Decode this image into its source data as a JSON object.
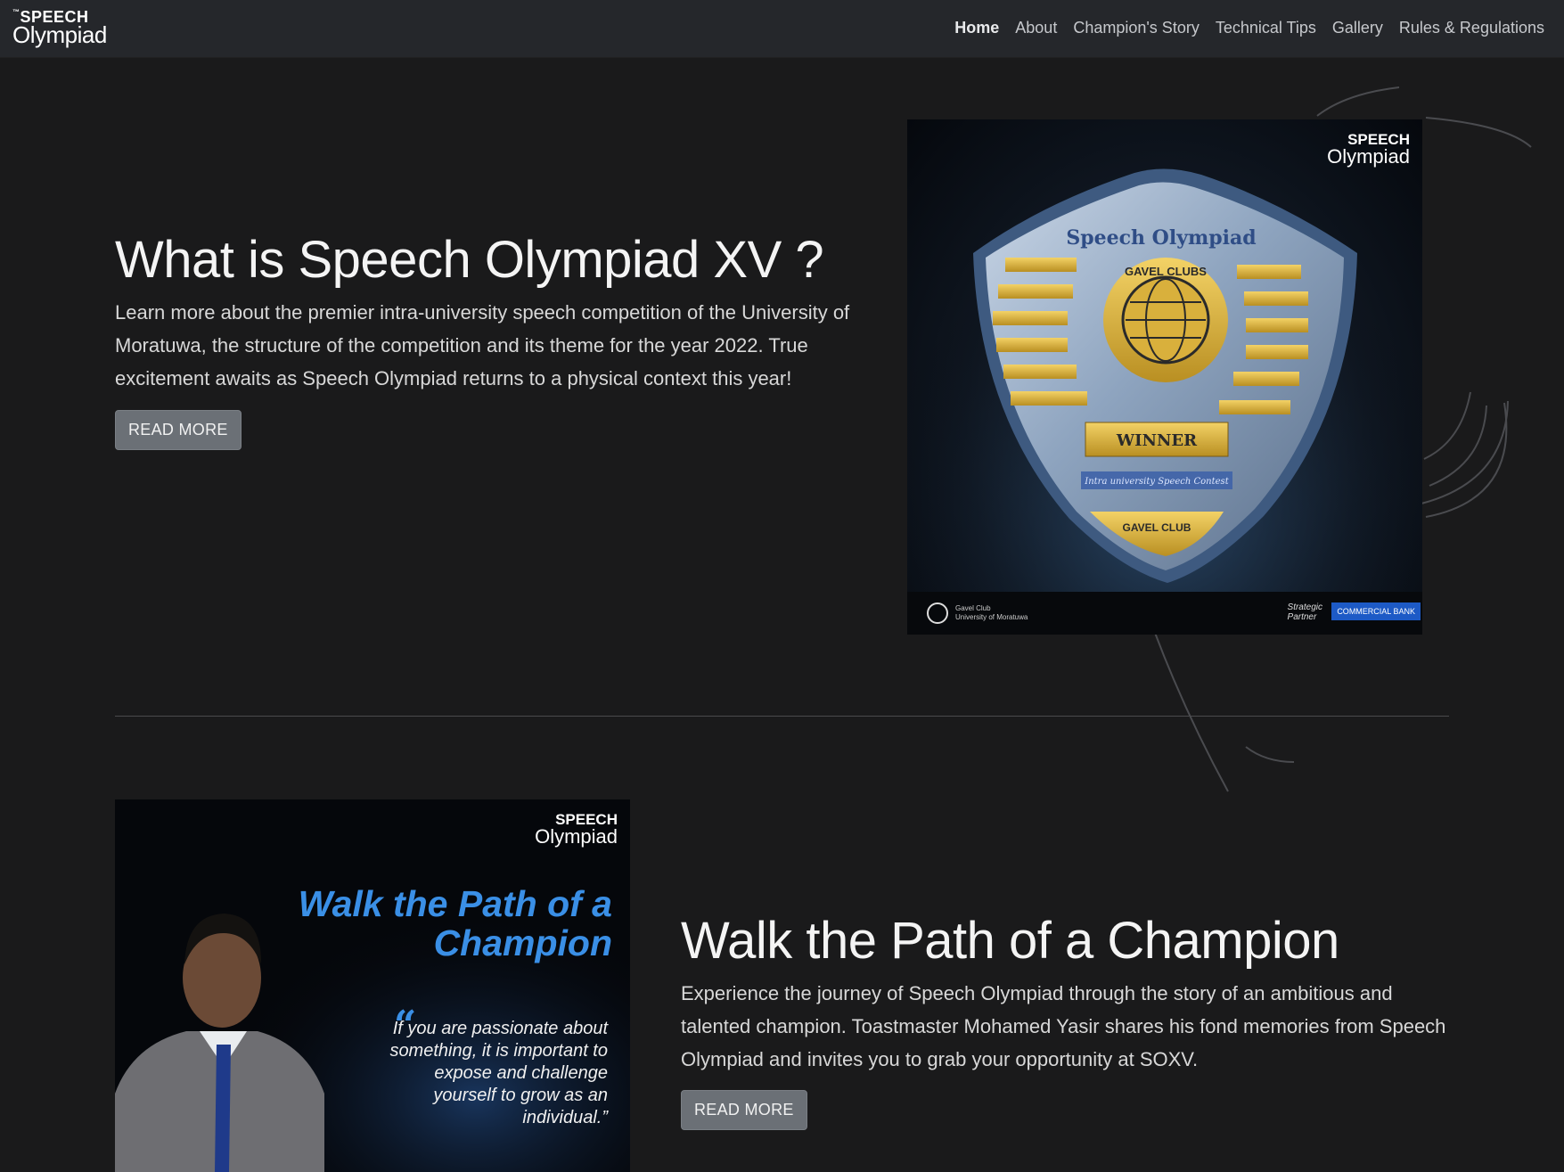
{
  "brand": {
    "tm": "™",
    "line1": "SPEECH",
    "line2": "Olympiad"
  },
  "nav": {
    "items": [
      {
        "label": "Home",
        "active": true
      },
      {
        "label": "About"
      },
      {
        "label": "Champion's Story"
      },
      {
        "label": "Technical Tips"
      },
      {
        "label": "Gallery"
      },
      {
        "label": "Rules & Regulations"
      }
    ]
  },
  "intro": {
    "title": "What is Speech Olympiad XV ?",
    "text": "Learn more about the premier intra-university speech competition of the University of Moratuwa, the structure of the competition and its theme for the year 2022. True excitement awaits as Speech Olympiad returns to a physical context this year!",
    "button": "READ MORE"
  },
  "trophy_poster": {
    "logo_line1": "SPEECH",
    "logo_line2": "Olympiad",
    "shield_title": "Speech Olympiad",
    "club_ring": "GAVEL CLUBS",
    "winner": "WINNER",
    "banner": "Intra university Speech Contest",
    "base": "GAVEL CLUB",
    "footer_left_1": "Gavel Club",
    "footer_left_2": "University of Moratuwa",
    "footer_partner_1": "Strategic",
    "footer_partner_2": "Partner",
    "footer_bank": "COMMERCIAL BANK"
  },
  "champion_poster": {
    "logo_line1": "SPEECH",
    "logo_line2": "Olympiad",
    "title_line1": "Walk the Path of a",
    "title_line2": "Champion",
    "quote_mark": "“",
    "quote": "If you are passionate about something, it is important to expose and challenge yourself to grow as an individual.”"
  },
  "champion": {
    "title": "Walk the Path of a Champion",
    "text": "Experience the journey of Speech Olympiad through the story of an ambitious and talented champion. Toastmaster Mohamed Yasir shares his fond memories from Speech Olympiad and invites you to grab your opportunity at SOXV.",
    "button": "READ MORE"
  }
}
